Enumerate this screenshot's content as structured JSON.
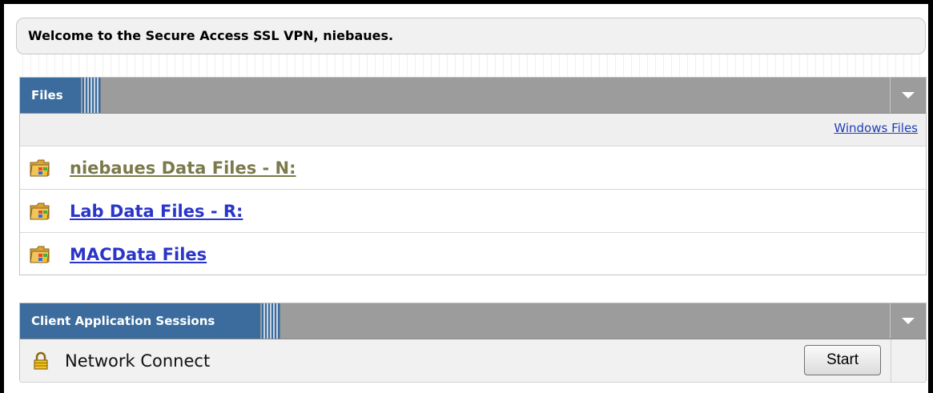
{
  "welcome": {
    "text": "Welcome to the Secure Access SSL VPN, niebaues."
  },
  "files_panel": {
    "title": "Files",
    "windows_files_link": "Windows Files",
    "items": [
      {
        "label": "niebaues Data Files - N:",
        "icon": "windows-folder-icon",
        "visited": true
      },
      {
        "label": "Lab Data Files - R:",
        "icon": "windows-folder-icon",
        "visited": false
      },
      {
        "label": "MACData Files",
        "icon": "windows-folder-icon",
        "visited": false
      }
    ]
  },
  "client_panel": {
    "title": "Client Application Sessions",
    "items": [
      {
        "label": "Network Connect",
        "icon": "lock-icon",
        "button_label": "Start"
      }
    ]
  },
  "colors": {
    "tab_blue": "#3b6c9d",
    "header_gray": "#9c9c9c",
    "link_blue": "#2a35c9",
    "visited_link": "#7a7a4a"
  }
}
